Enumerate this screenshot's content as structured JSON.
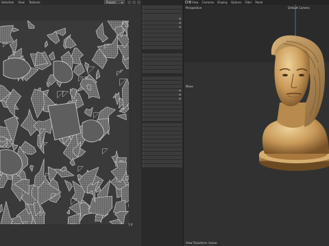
{
  "uv_editor": {
    "menu": [
      "Selection",
      "View",
      "Textures"
    ],
    "channel_select": "Project",
    "corner_label": "1,0"
  },
  "material_list": {
    "groups": [
      [
        "",
        "",
        ""
      ],
      [
        "",
        "",
        "",
        "",
        "",
        "",
        "",
        ""
      ],
      [
        "",
        "",
        "",
        "",
        ""
      ],
      [
        "",
        "",
        "",
        "",
        "",
        "",
        "",
        "",
        "",
        "",
        ""
      ],
      [
        "",
        "",
        "",
        "",
        "",
        "",
        "",
        "",
        "",
        "",
        ""
      ]
    ]
  },
  "viewport": {
    "menu": [
      "View",
      "Cameras",
      "Display",
      "Options",
      "Filter",
      "Panel"
    ],
    "projection_label": "Perspective",
    "camera_label": "Default Camera",
    "move_label": "Move",
    "footer": "View Transform: Scene"
  },
  "colors": {
    "uv_background": "#3a3a3a",
    "uv_lines": "#d8d8d8",
    "skin_highlight": "#e6c48a",
    "skin_shadow": "#8a5f2e",
    "pedestal": "#b98e52"
  }
}
